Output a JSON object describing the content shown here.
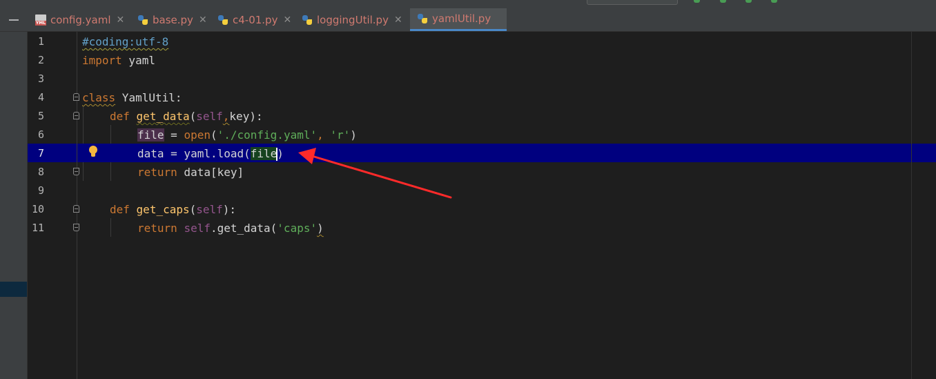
{
  "tabs": [
    {
      "label": "config.yaml",
      "icon": "yaml-file-icon",
      "active": false
    },
    {
      "label": "base.py",
      "icon": "python-file-icon",
      "active": false
    },
    {
      "label": "c4-01.py",
      "icon": "python-file-icon",
      "active": false
    },
    {
      "label": "loggingUtil.py",
      "icon": "python-file-icon",
      "active": false
    },
    {
      "label": "yamlUtil.py",
      "icon": "python-file-icon",
      "active": true
    }
  ],
  "close_glyph": "✕",
  "editor": {
    "current_line": 7,
    "line_numbers": [
      "1",
      "2",
      "3",
      "4",
      "5",
      "6",
      "7",
      "8",
      "9",
      "10",
      "11"
    ],
    "code": {
      "l1": {
        "comment": "#coding:utf-8"
      },
      "l2": {
        "kw": "import",
        "rest": " yaml"
      },
      "l4": {
        "kw": "class",
        "name": " YamlUtil",
        "colon": ":"
      },
      "l5": {
        "kw": "def",
        "fn": "get_data",
        "open": "(",
        "self": "self",
        "comma": ",",
        "arg": "key",
        "close": "):"
      },
      "l6": {
        "var": "file",
        "eq": " = ",
        "open_fn": "open",
        "p1": "(",
        "s1": "'./config.yaml'",
        "sep": ", ",
        "s2": "'r'",
        "p2": ")"
      },
      "l7": {
        "lhs": "data = yaml.load(",
        "arg": "file",
        "close": ")"
      },
      "l8": {
        "kw": "return",
        "rest": " data[key]"
      },
      "l10": {
        "kw": "def",
        "fn": "get_caps",
        "open": "(",
        "self": "self",
        "close": "):"
      },
      "l11": {
        "kw": "return",
        "self": "self",
        "call": ".get_data(",
        "str": "'caps'",
        "close": ")"
      }
    }
  },
  "colors": {
    "caret_row": "#00007f",
    "keyword": "#cc7832",
    "function": "#ffc66d",
    "self": "#94558d",
    "string": "#6a8759",
    "annotation_arrow": "#ff2a2a",
    "active_tab_underline": "#4a88c7"
  }
}
